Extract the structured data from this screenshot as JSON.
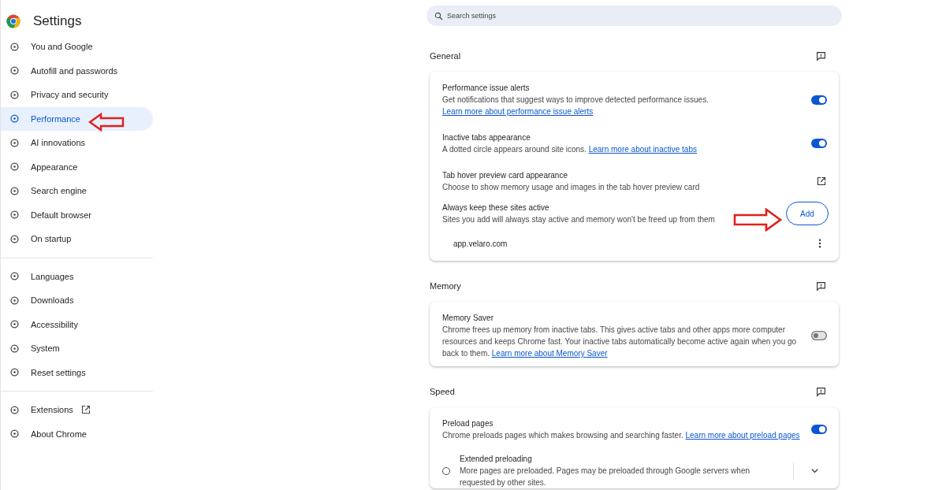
{
  "sidebar": {
    "title": "Settings",
    "groups": [
      {
        "items": [
          {
            "label": "You and Google",
            "selected": false
          },
          {
            "label": "Autofill and passwords",
            "selected": false
          },
          {
            "label": "Privacy and security",
            "selected": false
          },
          {
            "label": "Performance",
            "selected": true
          },
          {
            "label": "AI innovations",
            "selected": false
          },
          {
            "label": "Appearance",
            "selected": false
          },
          {
            "label": "Search engine",
            "selected": false
          },
          {
            "label": "Default browser",
            "selected": false
          },
          {
            "label": "On startup",
            "selected": false
          }
        ]
      },
      {
        "items": [
          {
            "label": "Languages",
            "selected": false
          },
          {
            "label": "Downloads",
            "selected": false
          },
          {
            "label": "Accessibility",
            "selected": false
          },
          {
            "label": "System",
            "selected": false
          },
          {
            "label": "Reset settings",
            "selected": false
          }
        ]
      },
      {
        "items": [
          {
            "label": "Extensions",
            "selected": false,
            "external": true
          },
          {
            "label": "About Chrome",
            "selected": false
          }
        ]
      }
    ]
  },
  "search": {
    "placeholder": "Search settings"
  },
  "sections": [
    {
      "title": "General",
      "rows": [
        {
          "kind": "toggle",
          "title": "Performance issue alerts",
          "description": "Get notifications that suggest ways to improve detected performance issues.",
          "link": "Learn more about performance issue alerts",
          "on": true
        },
        {
          "kind": "toggle",
          "title": "Inactive tabs appearance",
          "description": "A dotted circle appears around site icons.",
          "link": "Learn more about inactive tabs",
          "on": true
        },
        {
          "kind": "external",
          "title": "Tab hover preview card appearance",
          "description": "Choose to show memory usage and images in the tab hover preview card"
        },
        {
          "kind": "button",
          "title": "Always keep these sites active",
          "description": "Sites you add will always stay active and memory won't be freed up from them",
          "button": "Add"
        },
        {
          "kind": "site",
          "title": "app.velaro.com"
        }
      ]
    },
    {
      "title": "Memory",
      "rows": [
        {
          "kind": "toggle",
          "title": "Memory Saver",
          "description": "Chrome frees up memory from inactive tabs. This gives active tabs and other apps more computer resources and keeps Chrome fast. Your inactive tabs automatically become active again when you go back to them.",
          "link": "Learn more about Memory Saver",
          "on": false
        }
      ]
    },
    {
      "title": "Speed",
      "rows": [
        {
          "kind": "toggle",
          "title": "Preload pages",
          "description": "Chrome preloads pages which makes browsing and searching faster.",
          "link": "Learn more about preload pages",
          "on": true
        },
        {
          "kind": "radio",
          "title": "Extended preloading",
          "description": "More pages are preloaded. Pages may be preloaded through Google servers when requested by other sites.",
          "selected": false
        }
      ]
    }
  ]
}
